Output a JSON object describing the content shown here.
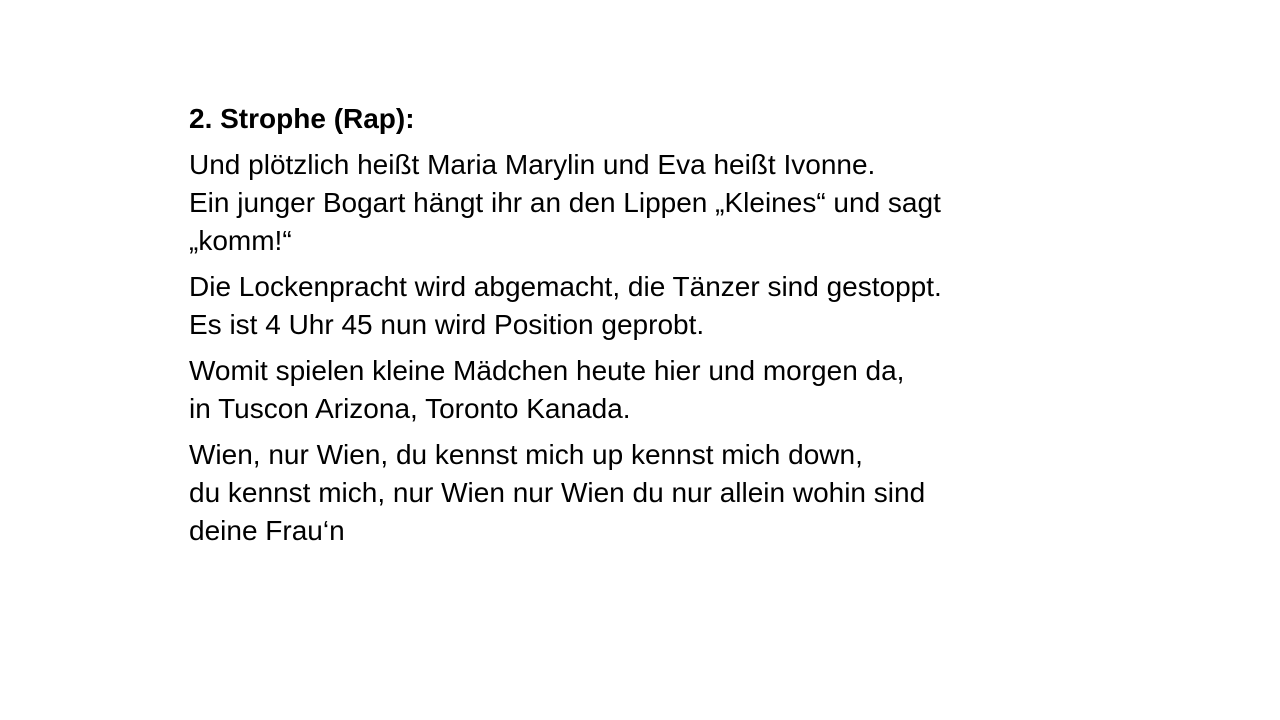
{
  "heading": "2. Strophe (Rap):",
  "stanzas": [
    {
      "lines": [
        "Und plötzlich heißt Maria Marylin und Eva heißt Ivonne.",
        "Ein junger Bogart hängt ihr an den Lippen „Kleines“ und sagt",
        "„komm!“"
      ]
    },
    {
      "lines": [
        "Die Lockenpracht wird abgemacht, die Tänzer sind gestoppt.",
        "Es ist 4 Uhr 45 nun wird Position geprobt."
      ]
    },
    {
      "lines": [
        "Womit spielen kleine Mädchen heute hier und morgen da,",
        "in Tuscon Arizona, Toronto Kanada."
      ]
    },
    {
      "lines": [
        "Wien, nur Wien, du kennst mich up kennst mich down,",
        "du kennst mich, nur Wien nur Wien du nur allein wohin sind",
        "deine Frau‘n"
      ]
    }
  ]
}
